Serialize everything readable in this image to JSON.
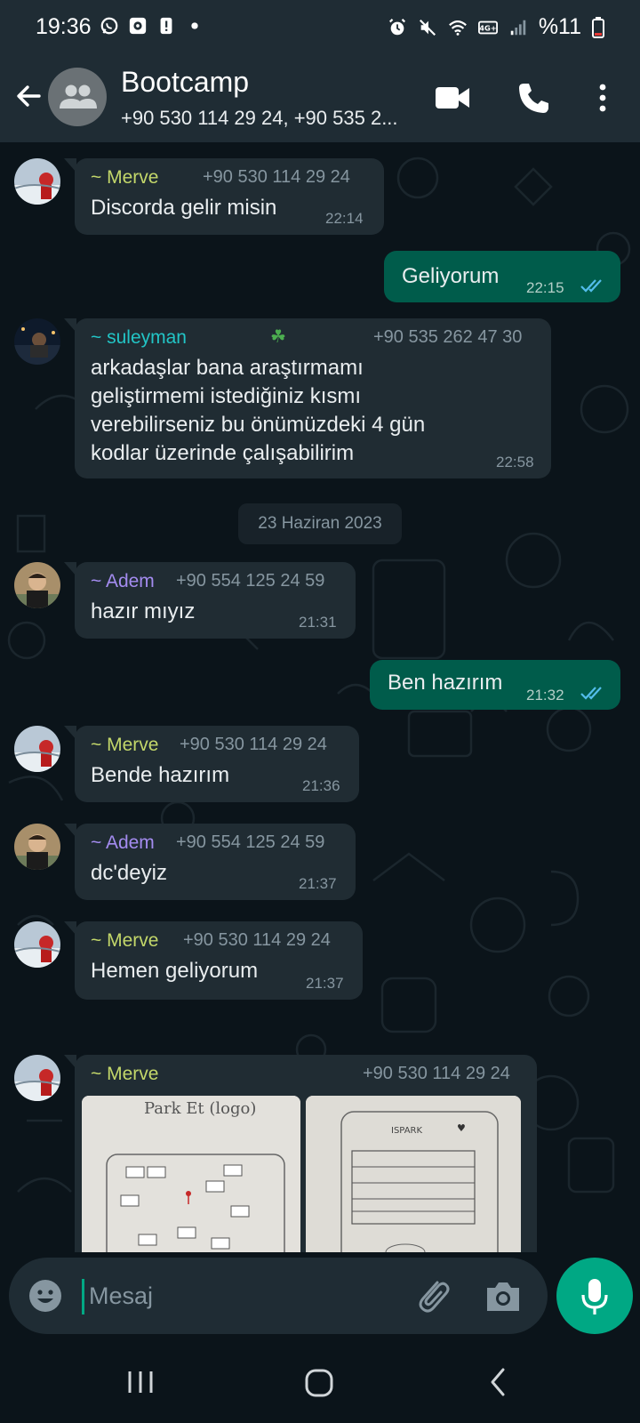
{
  "status_bar": {
    "time": "19:36",
    "battery": "%11",
    "network": "LTE+"
  },
  "header": {
    "title": "Bootcamp",
    "subtitle": "+90 530 114 29 24, +90 535 2..."
  },
  "date_separator": "23 Haziran 2023",
  "messages": [
    {
      "direction": "in",
      "sender": "~ Merve",
      "sender_color": "#c3d76a",
      "phone": "+90 530 114 29 24",
      "text": "Discorda gelir misin",
      "time": "22:14"
    },
    {
      "direction": "out",
      "text": "Geliyorum",
      "time": "22:15",
      "status": "read"
    },
    {
      "direction": "in",
      "sender": "~ suleyman",
      "sender_color": "#22c5c6",
      "phone": "+90 535 262 47 30",
      "lines": [
        "arkadaşlar bana araştırmamı",
        "geliştirmemi istediğiniz kısmı",
        "verebilirseniz bu önümüzdeki 4 gün",
        "kodlar üzerinde çalışabilirim"
      ],
      "time": "22:58"
    },
    {
      "direction": "in",
      "sender": "~ Adem",
      "sender_color": "#a48cf0",
      "phone": "+90 554 125 24 59",
      "text": "hazır mıyız",
      "time": "21:31"
    },
    {
      "direction": "out",
      "text": "Ben hazırım",
      "time": "21:32",
      "status": "read"
    },
    {
      "direction": "in",
      "sender": "~ Merve",
      "sender_color": "#c3d76a",
      "phone": "+90 530 114 29 24",
      "text": "Bende hazırım",
      "time": "21:36"
    },
    {
      "direction": "in",
      "sender": "~ Adem",
      "sender_color": "#a48cf0",
      "phone": "+90 554 125 24 59",
      "text": "dc'deyiz",
      "time": "21:37"
    },
    {
      "direction": "in",
      "sender": "~ Merve",
      "sender_color": "#c3d76a",
      "phone": "+90 530 114 29 24",
      "text": "Hemen geliyorum",
      "time": "21:37",
      "reaction": "👍"
    },
    {
      "direction": "in",
      "sender": "~ Merve",
      "sender_color": "#c3d76a",
      "phone": "+90 530 114 29 24",
      "images": [
        "Park Et (logo)",
        "ISPARK"
      ]
    }
  ],
  "input": {
    "placeholder": "Mesaj"
  },
  "colors": {
    "background": "#0b141a",
    "header": "#1f2c34",
    "incoming_bubble": "#202c33",
    "outgoing_bubble": "#005c4b",
    "accent": "#00a884",
    "read_ticks": "#53bdeb"
  },
  "icons": [
    "back-arrow-icon",
    "group-icon",
    "video-call-icon",
    "phone-icon",
    "more-vert-icon",
    "emoji-icon",
    "attach-icon",
    "camera-icon",
    "mic-icon",
    "chevron-double-down-icon"
  ]
}
